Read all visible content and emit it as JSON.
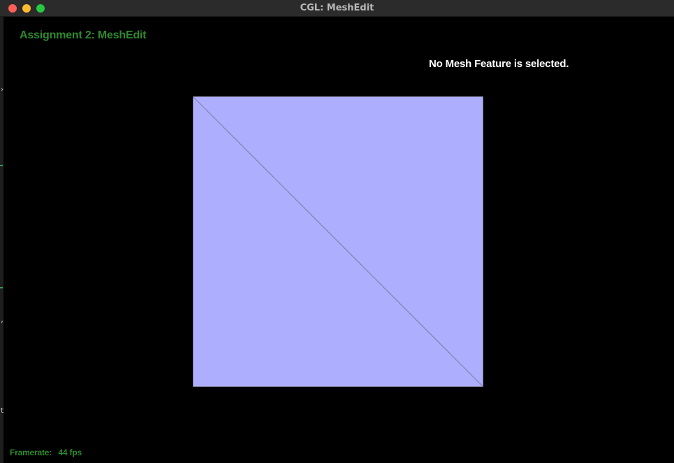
{
  "window": {
    "title": "CGL: MeshEdit"
  },
  "header": {
    "assignment_title": "Assignment 2: MeshEdit"
  },
  "status": {
    "selection_message": "No Mesh Feature is selected."
  },
  "mesh": {
    "face_color": "#aeaeff",
    "edge_color": "#6e6e8a",
    "triangle_count": 2
  },
  "footer": {
    "framerate_label": "Framerate:",
    "framerate_value": "44 fps"
  },
  "colors": {
    "accent_green": "#2e8a2e",
    "background": "#000000",
    "traffic_close": "#ff5f57",
    "traffic_minimize": "#febc2e",
    "traffic_maximize": "#28c840"
  }
}
